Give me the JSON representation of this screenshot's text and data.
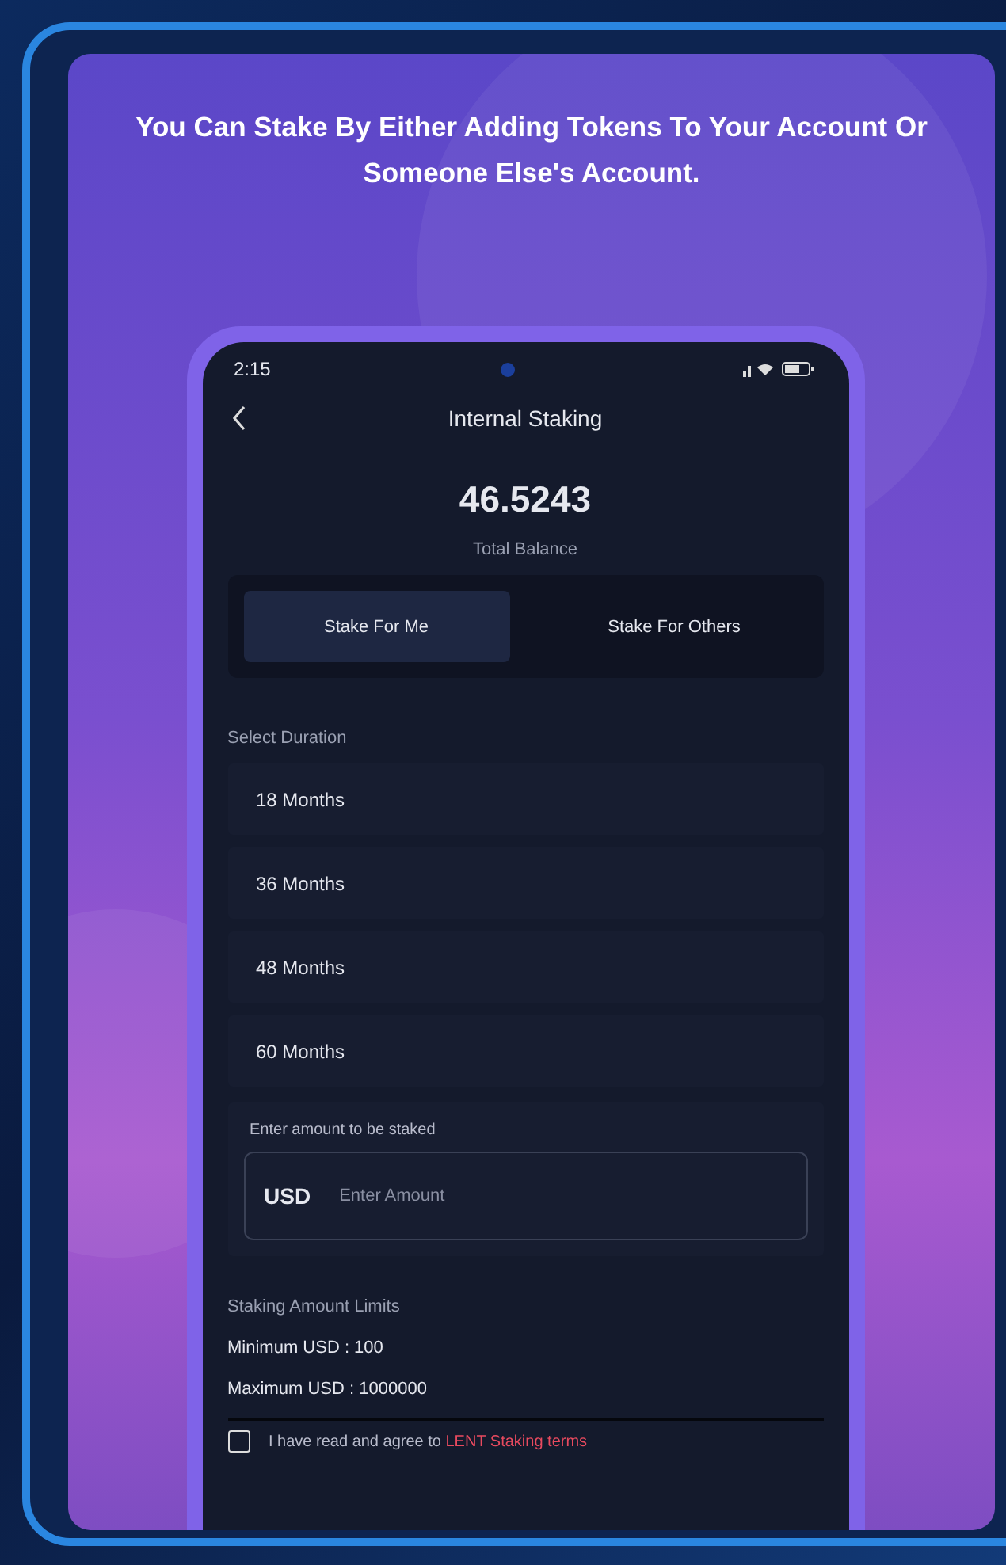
{
  "headline": "You Can Stake By Either Adding Tokens To Your Account Or Someone Else's Account.",
  "status_bar": {
    "time": "2:15"
  },
  "header": {
    "title": "Internal Staking"
  },
  "balance": {
    "amount": "46.5243",
    "label": "Total Balance"
  },
  "tabs": [
    {
      "label": "Stake For Me",
      "selected": true
    },
    {
      "label": "Stake For Others",
      "selected": false
    }
  ],
  "duration": {
    "label": "Select Duration",
    "options": [
      {
        "label": "18 Months",
        "selected": false
      },
      {
        "label": "36 Months",
        "selected": false
      },
      {
        "label": "48 Months",
        "selected": false
      },
      {
        "label": "60 Months",
        "selected": false
      }
    ]
  },
  "amount": {
    "label": "Enter amount to be staked",
    "currency": "USD",
    "placeholder": "Enter Amount"
  },
  "limits": {
    "title": "Staking Amount Limits",
    "lines": [
      "Minimum USD : 100",
      "Maximum USD : 1000000"
    ]
  },
  "agreement": {
    "checked": false,
    "text": "I have read and agree to",
    "link": "LENT Staking terms"
  }
}
